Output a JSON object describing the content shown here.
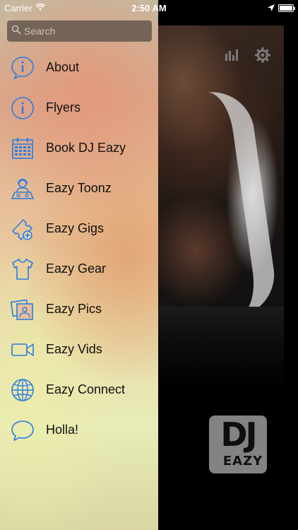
{
  "status_bar": {
    "carrier": "Carrier",
    "time": "2:50 AM"
  },
  "search": {
    "placeholder": "Search"
  },
  "menu": {
    "items": [
      {
        "label": "About",
        "icon": "info-icon"
      },
      {
        "label": "Flyers",
        "icon": "info-icon"
      },
      {
        "label": "Book DJ Eazy",
        "icon": "calendar-icon"
      },
      {
        "label": "Eazy Toonz",
        "icon": "dj-icon"
      },
      {
        "label": "Eazy Gigs",
        "icon": "ticket-icon"
      },
      {
        "label": "Eazy Gear",
        "icon": "shirt-icon"
      },
      {
        "label": "Eazy Pics",
        "icon": "photos-icon"
      },
      {
        "label": "Eazy Vids",
        "icon": "video-camera-icon"
      },
      {
        "label": "Eazy Connect",
        "icon": "globe-icon"
      },
      {
        "label": "Holla!",
        "icon": "chat-bubble-icon"
      }
    ]
  },
  "logo": {
    "line1": "DJ",
    "line2": "EAZY"
  },
  "colors": {
    "icon_blue": "#2a7de1",
    "search_bg": "#5a5046",
    "main_bg": "#000000"
  }
}
